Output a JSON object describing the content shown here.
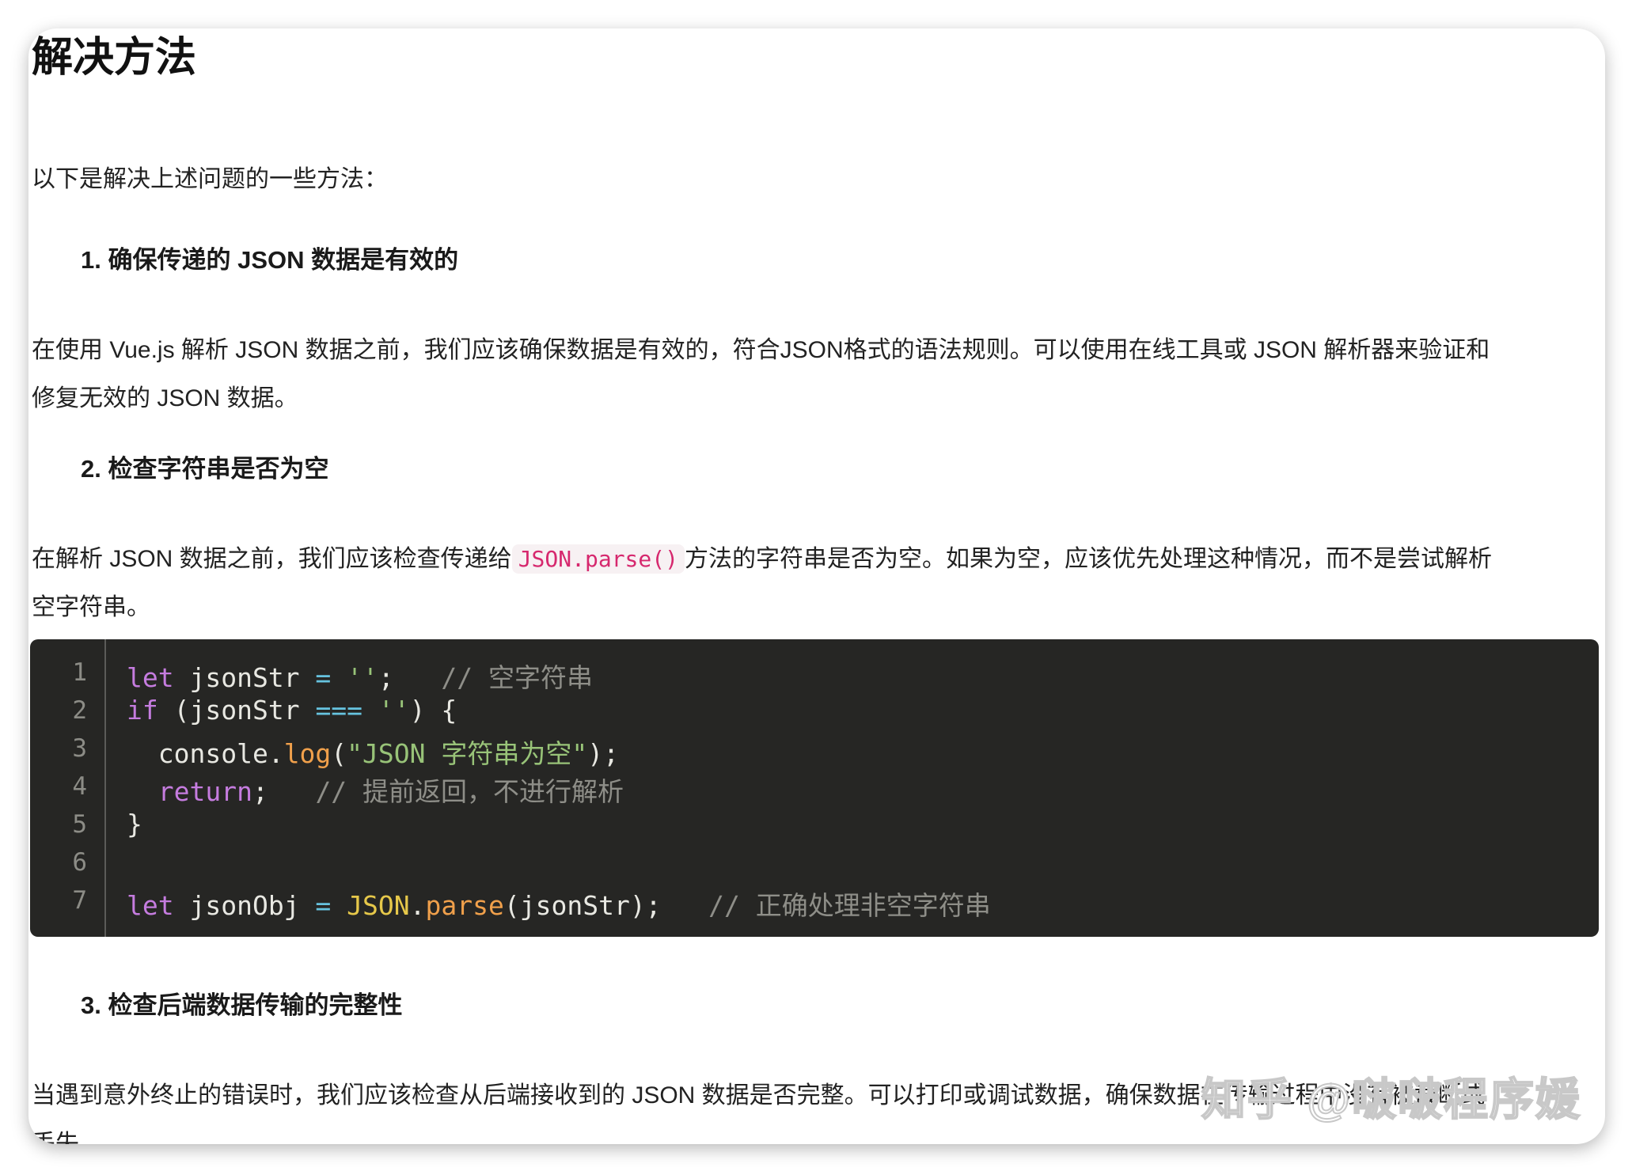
{
  "heading": "解决方法",
  "intro": "以下是解决上述问题的一些方法：",
  "section1": {
    "title": "1. 确保传递的 JSON 数据是有效的",
    "body_line1": "在使用 Vue.js 解析 JSON 数据之前，我们应该确保数据是有效的，符合JSON格式的语法规则。可以使用在线工具或 JSON 解析器来验证和",
    "body_line2": "修复无效的 JSON 数据。"
  },
  "section2": {
    "title": "2. 检查字符串是否为空",
    "body_before": "在解析 JSON 数据之前，我们应该检查传递给",
    "inline_code": "JSON.parse()",
    "body_after": "方法的字符串是否为空。如果为空，应该优先处理这种情况，而不是尝试解析",
    "body_line2": "空字符串。"
  },
  "code": {
    "line_numbers": [
      "1",
      "2",
      "3",
      "4",
      "5",
      "6",
      "7"
    ],
    "lines": [
      {
        "t1": "let",
        "t2": " jsonStr ",
        "t3": "=",
        "t4": " ",
        "t5": "''",
        "t6": ";   ",
        "t7": "// 空字符串"
      },
      {
        "t1": "if",
        "t2": " (jsonStr ",
        "t3": "===",
        "t4": " ",
        "t5": "''",
        "t6": ") {",
        "t7": ""
      },
      {
        "t1": "  console.",
        "t2": "log",
        "t3": "(",
        "t4": "\"JSON 字符串为空\"",
        "t5": ");",
        "t6": "",
        "t7": ""
      },
      {
        "t1": "  return",
        "t2": ";   ",
        "t3": "// 提前返回，不进行解析",
        "t4": "",
        "t5": "",
        "t6": "",
        "t7": ""
      },
      {
        "t1": "}",
        "t2": "",
        "t3": "",
        "t4": "",
        "t5": "",
        "t6": "",
        "t7": ""
      },
      {
        "t1": "",
        "t2": "",
        "t3": "",
        "t4": "",
        "t5": "",
        "t6": "",
        "t7": ""
      },
      {
        "t1": "let",
        "t2": " jsonObj ",
        "t3": "=",
        "t4": " ",
        "t5": "JSON",
        "t6": ".",
        "t7": "parse",
        "t8": "(jsonStr);   ",
        "t9": "// 正确处理非空字符串"
      }
    ]
  },
  "section3": {
    "title": "3. 检查后端数据传输的完整性",
    "body_line1": "当遇到意外终止的错误时，我们应该检查从后端接收到的 JSON 数据是否完整。可以打印或调试数据，确保数据在传输过程中没有被截断或",
    "body_line2": "丢失。"
  },
  "watermark": "知乎 @啵啵程序媛",
  "colors": {
    "code_background": "#262624",
    "keyword": "#c57cdf",
    "string": "#98c378",
    "comment": "#8e8e88",
    "function": "#f0a04b",
    "inline_code": "#d6286e"
  }
}
